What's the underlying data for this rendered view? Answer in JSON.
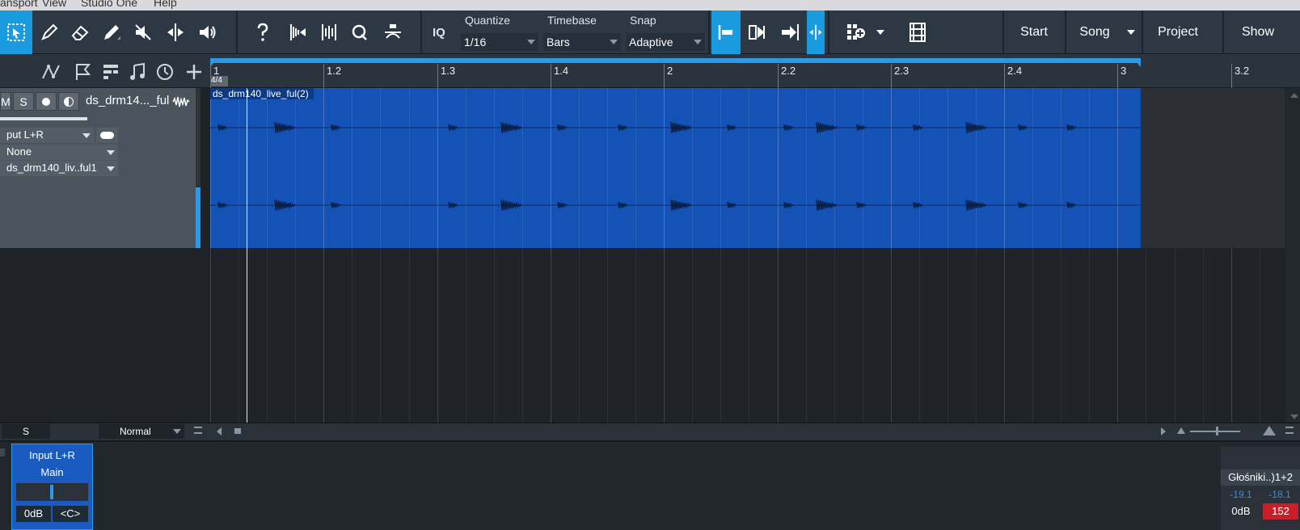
{
  "menu": [
    "ansport",
    "View",
    "Studio One",
    "Help"
  ],
  "toolbar": {
    "iq": "IQ",
    "quantize": {
      "label": "Quantize",
      "value": "1/16"
    },
    "timebase": {
      "label": "Timebase",
      "value": "Bars"
    },
    "snap": {
      "label": "Snap",
      "value": "Adaptive"
    },
    "nav": {
      "start": "Start",
      "song": "Song",
      "project": "Project",
      "show": "Show"
    }
  },
  "track": {
    "buttons": {
      "mute": "M",
      "solo": "S"
    },
    "name": "ds_drm14..._ful",
    "input": "put L+R",
    "output": "None",
    "playlist": "ds_drm140_liv..ful1"
  },
  "ruler": {
    "time_signature": "4/4",
    "marks": [
      "1",
      "1.2",
      "1.3",
      "1.4",
      "2",
      "2.2",
      "2.3",
      "2.4",
      "3",
      "3.2"
    ]
  },
  "event": {
    "name": "ds_drm140_live_ful(2)"
  },
  "statusbar": {
    "s": "S",
    "mode": "Normal"
  },
  "console": {
    "channel": {
      "input": "Input L+R",
      "output": "Main",
      "volume": "0dB",
      "pan": "<C>"
    },
    "master": {
      "name": "Głośniki..)1+2",
      "peak_left": "-19.1",
      "peak_right": "-18.1",
      "volume": "0dB",
      "badge": "152"
    }
  },
  "colors": {
    "accent": "#1a9be0",
    "event": "#1452b5",
    "clip_red": "#c8202b"
  }
}
